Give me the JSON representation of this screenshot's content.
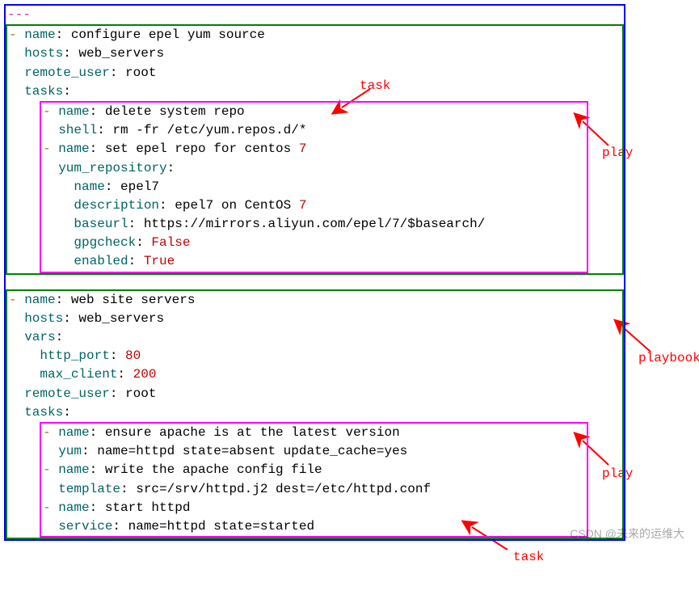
{
  "labels": {
    "task1": "task",
    "task2": "task",
    "play1": "play",
    "play2": "play",
    "playbook": "playbook"
  },
  "watermark": "CSDN @未来的运维大",
  "code": {
    "doc_start": "---",
    "play1": {
      "name_key": "name",
      "name_val": "configure epel yum source",
      "hosts_key": "hosts",
      "hosts_val": "web_servers",
      "ru_key": "remote_user",
      "ru_val": "root",
      "tasks_key": "tasks",
      "t1": {
        "name_key": "name",
        "name_val": "delete system repo",
        "shell_key": "shell",
        "shell_val": "rm -fr /etc/yum.repos.d/*"
      },
      "t2": {
        "name_key": "name",
        "name_val": "set epel repo for centos ",
        "name_num": "7",
        "yr_key": "yum_repository",
        "yr_name_key": "name",
        "yr_name_val": "epel7",
        "yr_desc_key": "description",
        "yr_desc_val": "epel7 on CentOS ",
        "yr_desc_num": "7",
        "yr_baseurl_key": "baseurl",
        "yr_baseurl_val": "https://mirrors.aliyun.com/epel/7/$basearch/",
        "yr_gpg_key": "gpgcheck",
        "yr_gpg_val": "False",
        "yr_en_key": "enabled",
        "yr_en_val": "True"
      }
    },
    "play2": {
      "name_key": "name",
      "name_val": "web site servers",
      "hosts_key": "hosts",
      "hosts_val": "web_servers",
      "vars_key": "vars",
      "http_key": "http_port",
      "http_val": "80",
      "max_key": "max_client",
      "max_val": "200",
      "ru_key": "remote_user",
      "ru_val": "root",
      "tasks_key": "tasks",
      "t1": {
        "name_key": "name",
        "name_val": "ensure apache is at the latest version",
        "yum_key": "yum",
        "yum_val": "name=httpd state=absent update_cache=yes"
      },
      "t2": {
        "name_key": "name",
        "name_val": "write the apache config file",
        "tmpl_key": "template",
        "tmpl_val": "src=/srv/httpd.j2 dest=/etc/httpd.conf"
      },
      "t3": {
        "name_key": "name",
        "name_val": "start httpd",
        "srv_key": "service",
        "srv_val": "name=httpd state=started"
      }
    }
  }
}
